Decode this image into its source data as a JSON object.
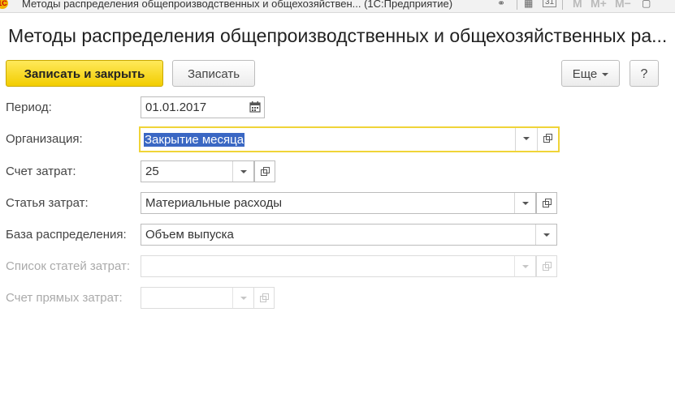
{
  "window": {
    "title": "Методы распределения общепроизводственных и общехозяйствен...  (1С:Предприятие)",
    "toolbar": {
      "m": "M",
      "m_plus": "M+",
      "m_minus": "M−"
    }
  },
  "form": {
    "title": "Методы распределения общепроизводственных и общехозяйственных ра...",
    "buttons": {
      "save_close": "Записать и закрыть",
      "save": "Записать",
      "more": "Еще",
      "help": "?"
    },
    "fields": {
      "period": {
        "label": "Период:",
        "value": "01.01.2017"
      },
      "organization": {
        "label": "Организация:",
        "value": "Закрытие месяца"
      },
      "cost_account": {
        "label": "Счет затрат:",
        "value": "25"
      },
      "cost_item": {
        "label": "Статья затрат:",
        "value": "Материальные расходы"
      },
      "distribution_base": {
        "label": "База распределения:",
        "value": "Объем выпуска"
      },
      "cost_items_list": {
        "label": "Список статей затрат:",
        "value": ""
      },
      "direct_cost_account": {
        "label": "Счет прямых затрат:",
        "value": ""
      }
    }
  },
  "colors": {
    "primary_button": "#f5d20f",
    "focus_border": "#f0d438",
    "selection": "#3a67c3"
  }
}
